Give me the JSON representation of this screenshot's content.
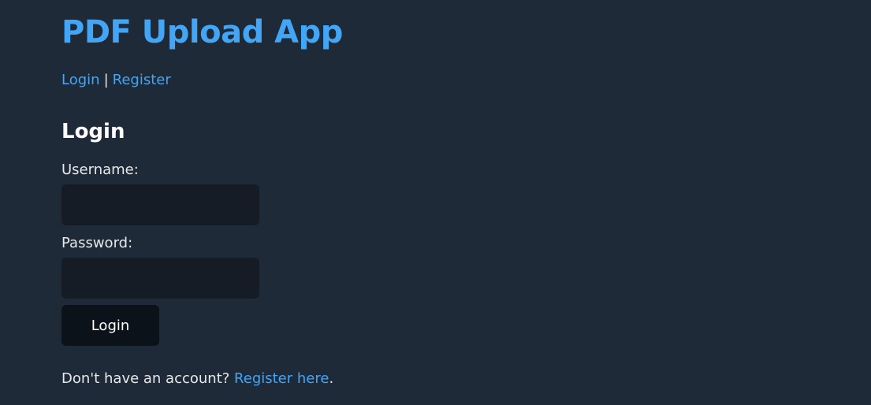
{
  "header": {
    "title": "PDF Upload App"
  },
  "nav": {
    "login_label": "Login",
    "separator": "|",
    "register_label": "Register"
  },
  "login_form": {
    "heading": "Login",
    "username_label": "Username:",
    "username_value": "",
    "password_label": "Password:",
    "password_value": "",
    "submit_label": "Login"
  },
  "footer": {
    "prompt_text": "Don't have an account? ",
    "register_link_label": "Register here",
    "trailing_text": "."
  },
  "colors": {
    "background": "#1f2a38",
    "accent": "#42a5f5",
    "input_background": "#161c25",
    "button_background": "#0c1219",
    "text": "#e6e8eb"
  }
}
